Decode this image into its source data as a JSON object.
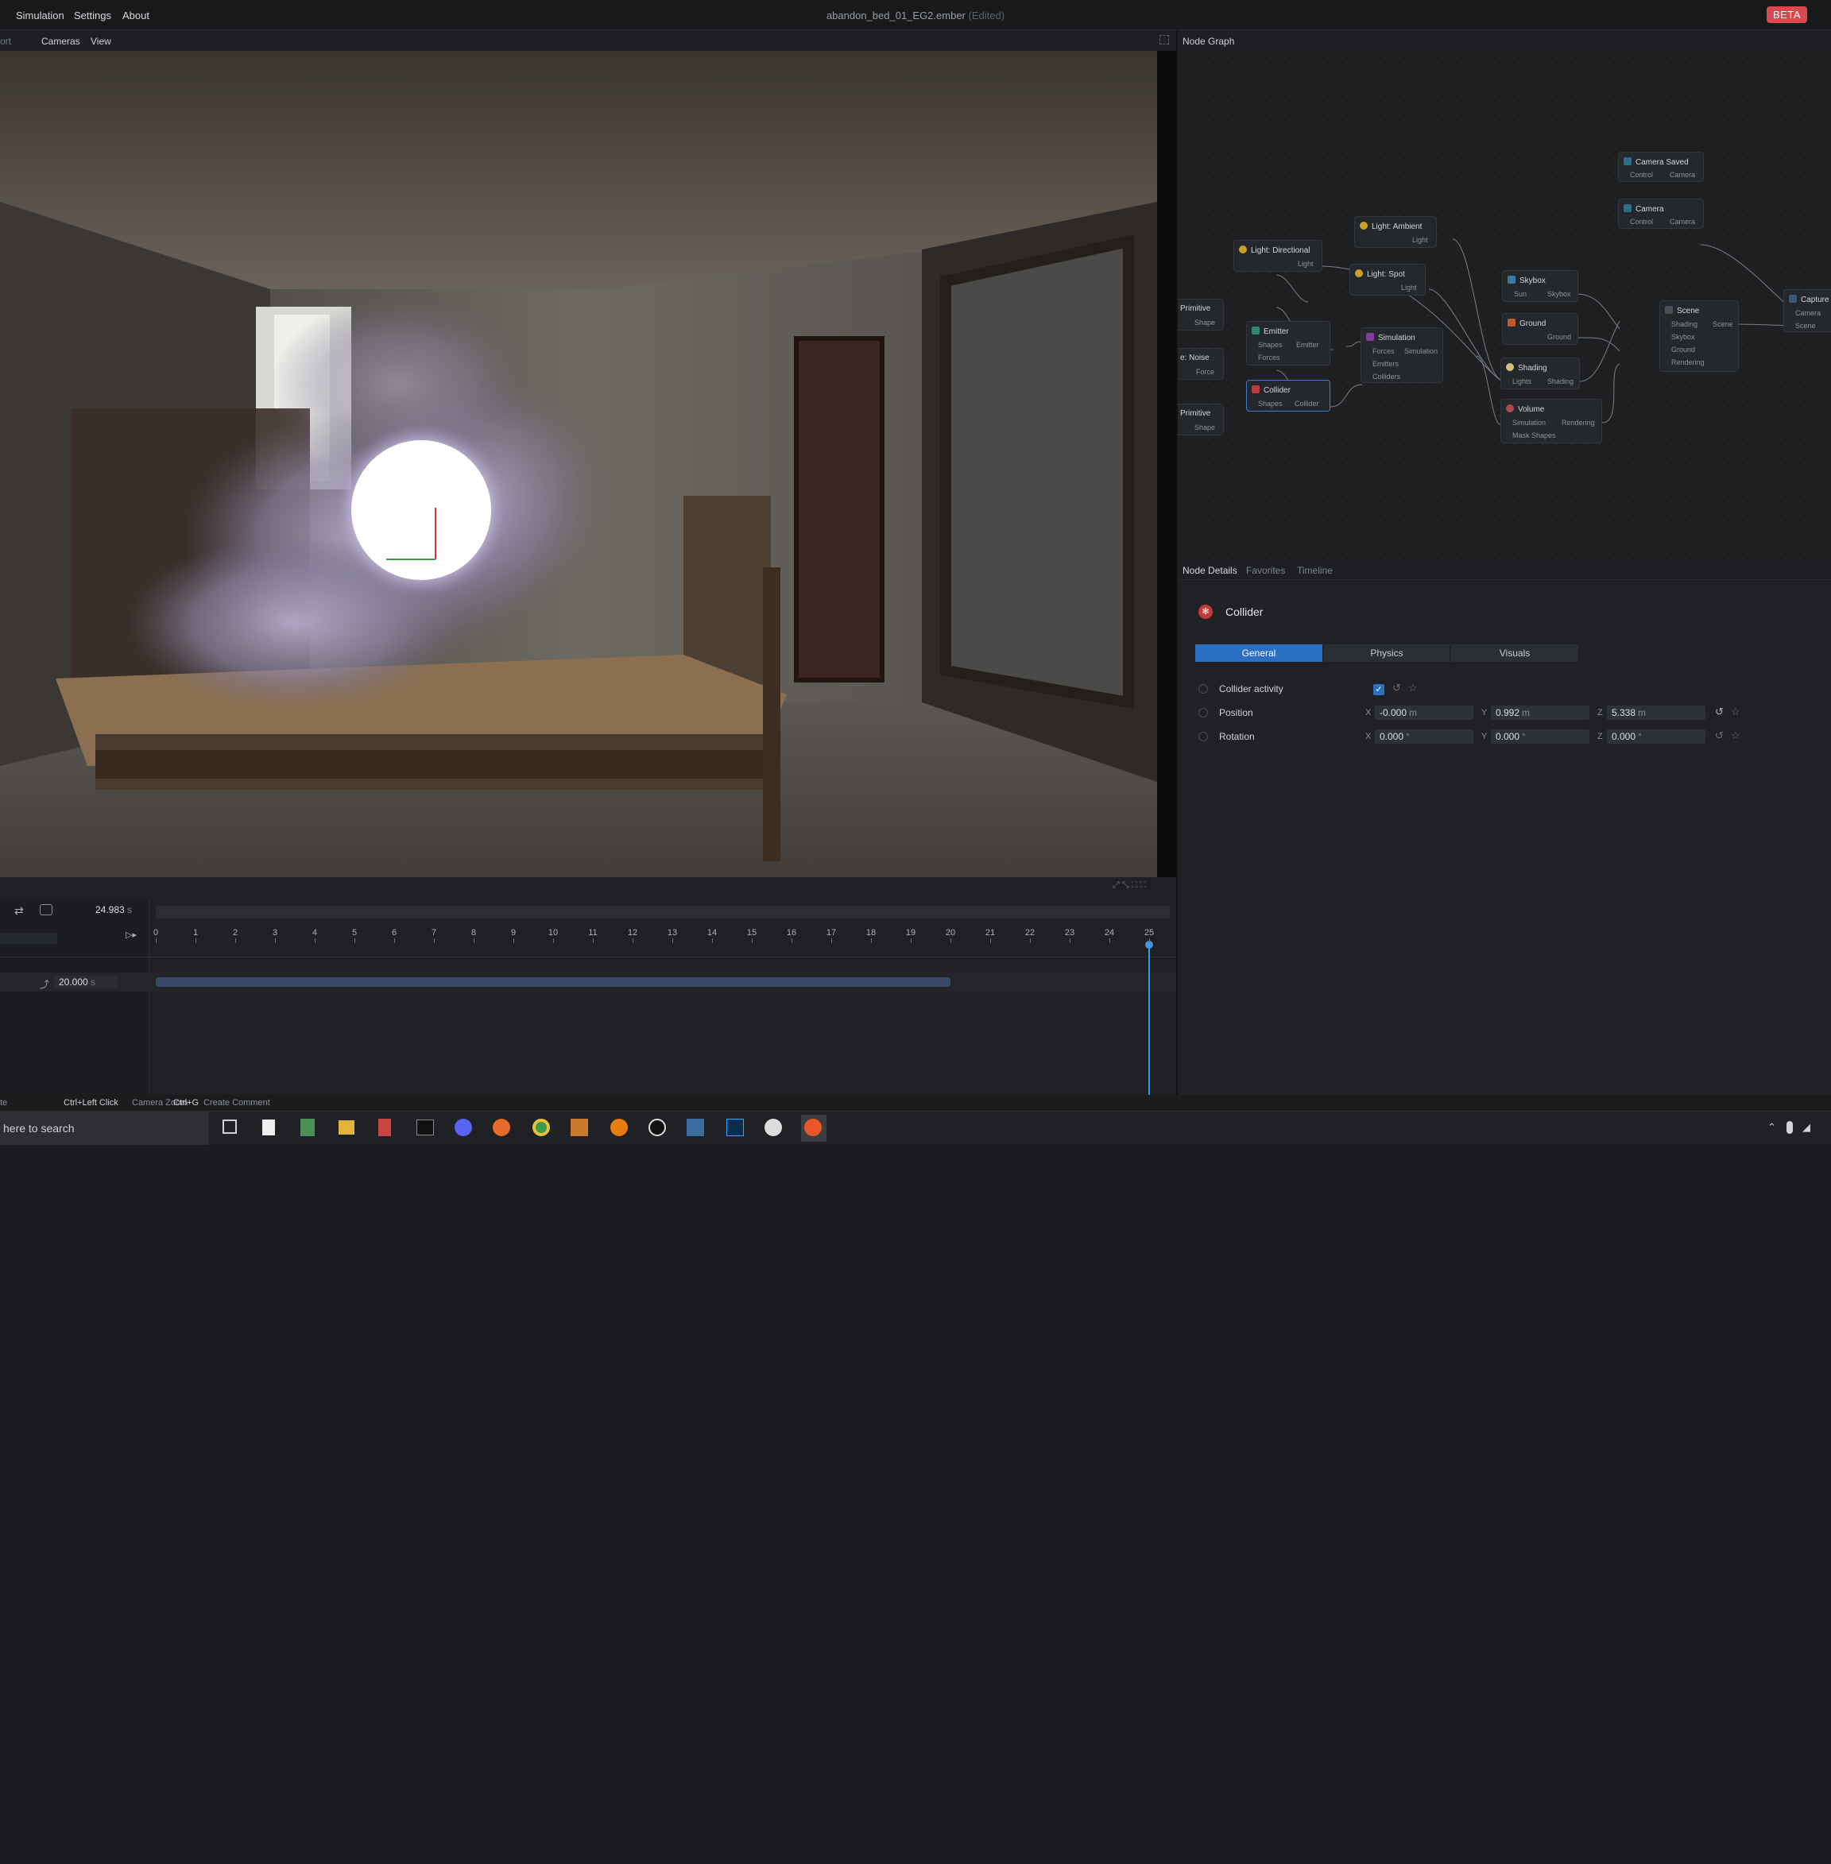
{
  "menu": {
    "items": [
      "Simulation",
      "Settings",
      "About"
    ]
  },
  "document": {
    "title": "abandon_bed_01_EG2.ember",
    "edited": "(Edited)"
  },
  "beta_badge": "BETA",
  "viewport": {
    "tab_cut": "ort",
    "menus": [
      "Cameras",
      "View"
    ]
  },
  "node_graph": {
    "title": "Node Graph",
    "nodes": {
      "camera_saved": {
        "title": "Camera Saved",
        "in": "Control",
        "out": "Camera"
      },
      "camera": {
        "title": "Camera",
        "in": "Control",
        "out": "Camera"
      },
      "capture": {
        "title": "Capture",
        "in1": "Camera",
        "in2": "Scene"
      },
      "light_ambient": {
        "title": "Light: Ambient",
        "out": "Light"
      },
      "light_directional": {
        "title": "Light: Directional",
        "out": "Light"
      },
      "light_spot": {
        "title": "Light: Spot",
        "out": "Light"
      },
      "skybox": {
        "title": "Skybox",
        "in": "Sun",
        "out": "Skybox"
      },
      "ground": {
        "title": "Ground",
        "out": "Ground"
      },
      "scene": {
        "title": "Scene",
        "in1": "Shading",
        "in2": "Skybox",
        "in3": "Ground",
        "in4": "Rendering",
        "out": "Scene"
      },
      "primitive_a": {
        "title": "Primitive",
        "out": "Shape"
      },
      "noise": {
        "title": "e: Noise",
        "out": "Force"
      },
      "primitive_b": {
        "title": "Primitive",
        "out": "Shape"
      },
      "emitter": {
        "title": "Emitter",
        "in1": "Shapes",
        "in2": "Forces",
        "out": "Emitter"
      },
      "collider": {
        "title": "Collider",
        "in": "Shapes",
        "out": "Collider"
      },
      "simulation": {
        "title": "Simulation",
        "in1": "Forces",
        "in2": "Emitters",
        "in3": "Colliders",
        "out": "Simulation"
      },
      "shading": {
        "title": "Shading",
        "in": "Lights",
        "out": "Shading"
      },
      "volume": {
        "title": "Volume",
        "in1": "Simulation",
        "in2": "Mask Shapes",
        "out": "Rendering"
      }
    }
  },
  "panel": {
    "tabs": [
      "Node Details",
      "Favorites",
      "Timeline"
    ],
    "node_title": "Collider",
    "segments": [
      "General",
      "Physics",
      "Visuals"
    ],
    "props": {
      "activity": {
        "label": "Collider activity",
        "checked": true
      },
      "position": {
        "label": "Position",
        "x": "-0.000",
        "y": "0.992",
        "z": "5.338",
        "unit": "m"
      },
      "rotation": {
        "label": "Rotation",
        "x": "0.000",
        "y": "0.000",
        "z": "0.000",
        "unit": "°"
      }
    },
    "axes": [
      "X",
      "Y",
      "Z"
    ]
  },
  "timeline": {
    "current_time": "24.983",
    "unit": "s",
    "duration": "20.000",
    "ticks": [
      "0",
      "1",
      "2",
      "3",
      "4",
      "5",
      "6",
      "7",
      "8",
      "9",
      "10",
      "11",
      "12",
      "13",
      "14",
      "15",
      "16",
      "17",
      "18",
      "19",
      "20",
      "21",
      "22",
      "23",
      "24",
      "25"
    ]
  },
  "statusbar": {
    "cut": "te",
    "hint1_key": "Ctrl+Left Click",
    "hint1_action": "Camera Zoom",
    "hint2_key": "Ctrl+G",
    "hint2_action": "Create Comment"
  },
  "taskbar": {
    "search": "here to search"
  },
  "colors": {
    "accent": "#2a6fc2",
    "beta": "#d9484e",
    "playhead": "#3f95e8"
  }
}
